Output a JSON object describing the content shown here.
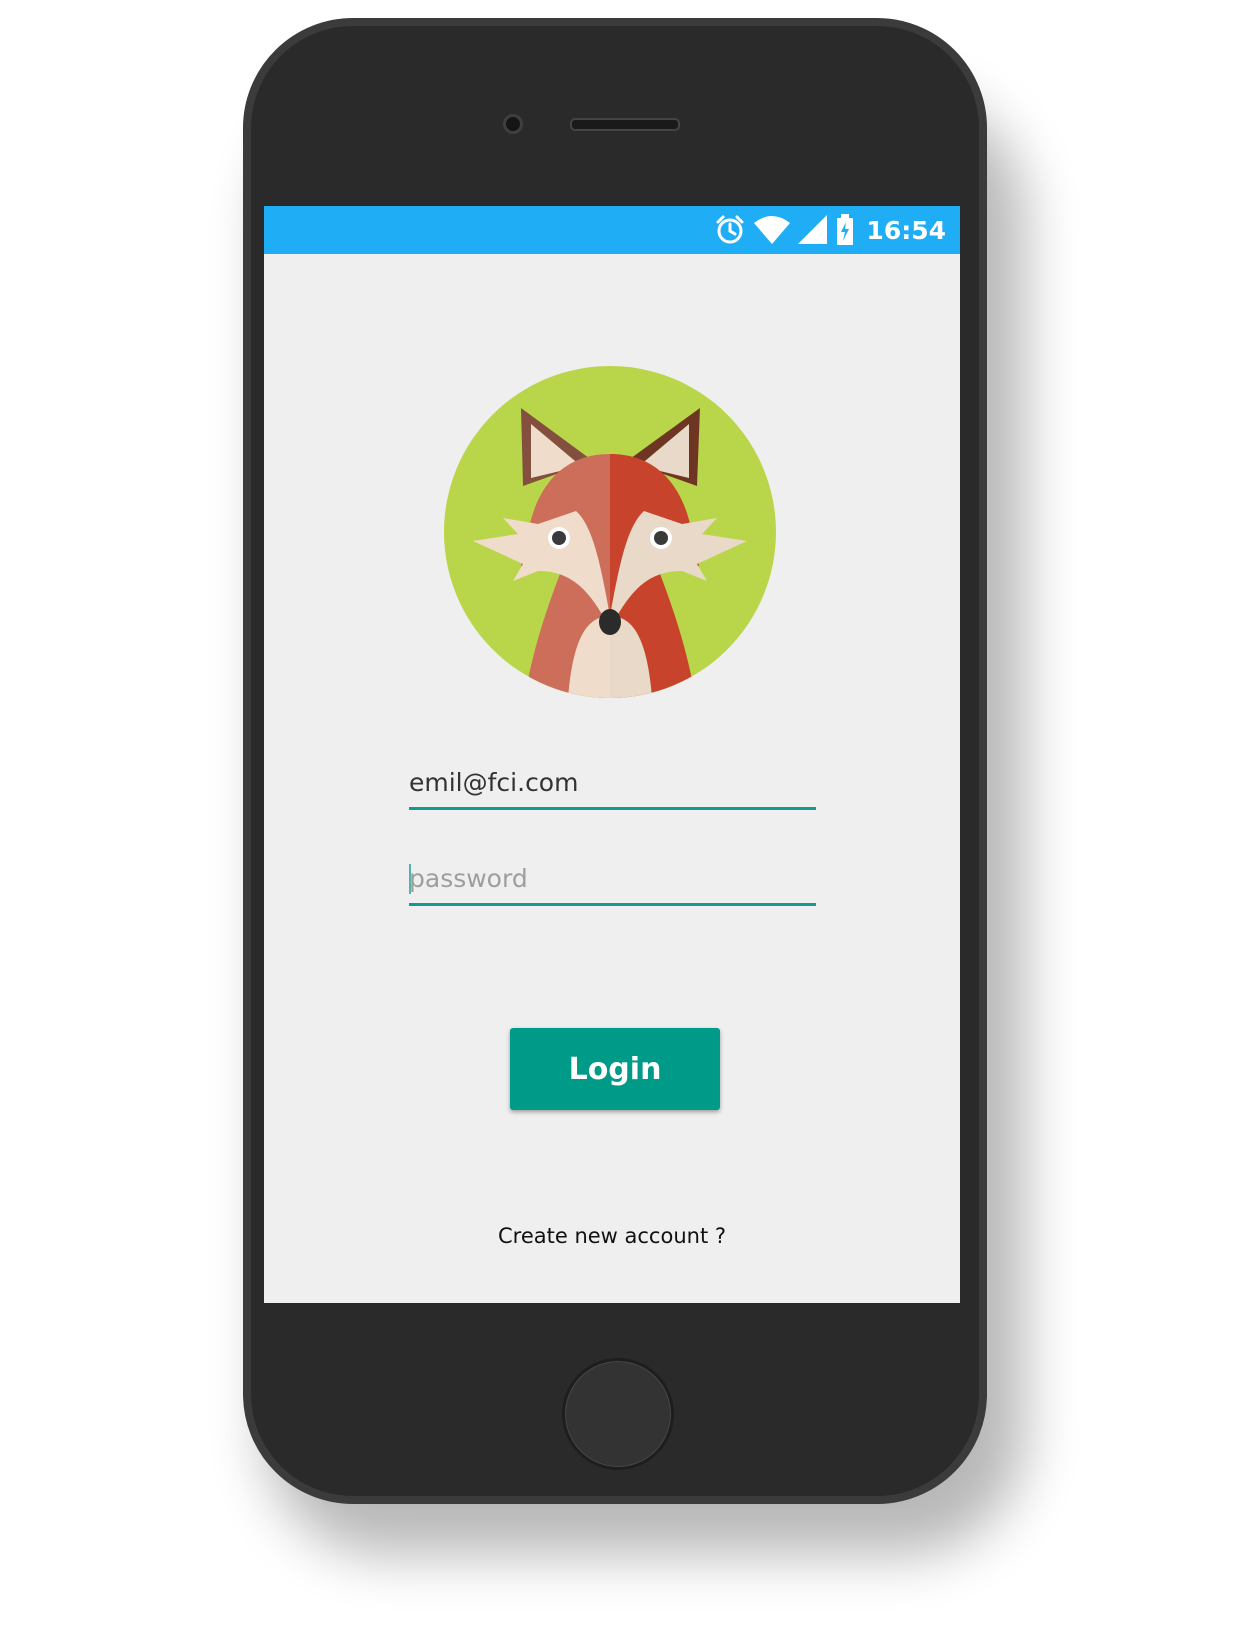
{
  "status_bar": {
    "time": "16:54",
    "icons": [
      "alarm-icon",
      "wifi-icon",
      "signal-icon",
      "battery-charging-icon"
    ],
    "color": "#1faef5"
  },
  "login_form": {
    "email_value": "emil@fci.com",
    "password_placeholder": "password",
    "login_label": "Login",
    "create_account_label": "Create new account ?"
  },
  "colors": {
    "accent": "#009a89",
    "avatar_background": "#b9d64a",
    "fox_red": "#c7432b"
  }
}
